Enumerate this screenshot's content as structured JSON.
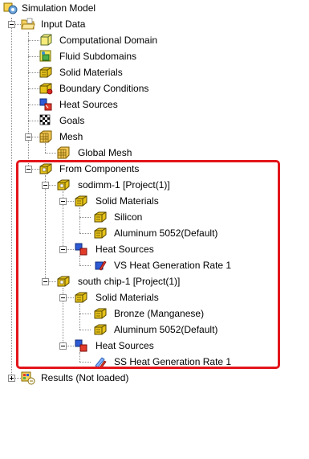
{
  "tree": {
    "root": "Simulation Model",
    "input_data": "Input Data",
    "computational_domain": "Computational Domain",
    "fluid_subdomains": "Fluid Subdomains",
    "solid_materials": "Solid Materials",
    "boundary_conditions": "Boundary Conditions",
    "heat_sources": "Heat Sources",
    "goals": "Goals",
    "mesh": "Mesh",
    "global_mesh": "Global Mesh",
    "from_components": "From Components",
    "sodimm": {
      "label": "sodimm-1 [Project(1)]",
      "solid_materials": "Solid Materials",
      "silicon": "Silicon",
      "aluminum": "Aluminum 5052(Default)",
      "heat_sources": "Heat Sources",
      "vs_heat": "VS Heat Generation Rate 1"
    },
    "south_chip": {
      "label": "south chip-1 [Project(1)]",
      "solid_materials": "Solid Materials",
      "bronze": "Bronze (Manganese)",
      "aluminum": "Aluminum 5052(Default)",
      "heat_sources": "Heat Sources",
      "ss_heat": "SS Heat Generation Rate 1"
    },
    "results": "Results (Not loaded)"
  },
  "colors": {
    "highlight_border": "#e3151a",
    "connector": "#8a8a8a",
    "folder_yellow": "#f4d160",
    "material_yellow": "#e6c21a"
  }
}
